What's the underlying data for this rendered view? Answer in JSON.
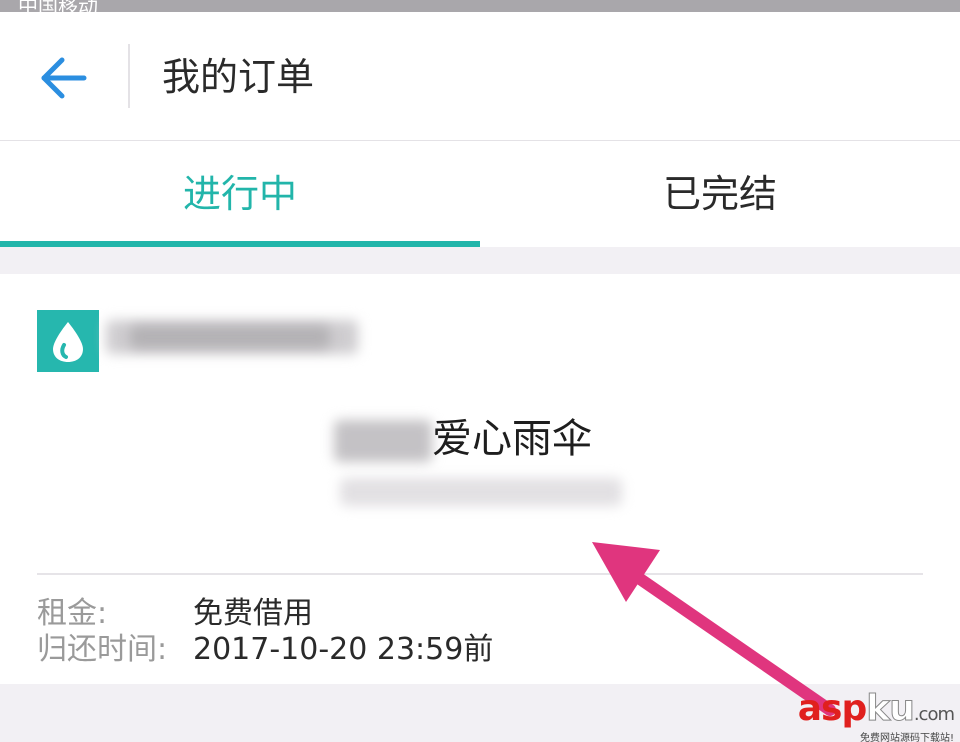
{
  "status_bar": {
    "carrier": "中国移动"
  },
  "header": {
    "title": "我的订单"
  },
  "tabs": [
    {
      "label": "进行中",
      "active": true
    },
    {
      "label": "已完结",
      "active": false
    }
  ],
  "order": {
    "item_name": "爱心雨伞",
    "rent_label": "租金:",
    "rent_value": "免费借用",
    "return_label": "归还时间:",
    "return_value": "2017-10-20 23:59前"
  },
  "watermark": {
    "brand_asp": "asp",
    "brand_ku": "ku",
    "brand_com": ".com",
    "tagline": "免费网站源码下载站!"
  },
  "colors": {
    "accent": "#22b5aa",
    "back_arrow": "#2b8ee0",
    "annotation": "#e0357e",
    "watermark_red": "#e0201e"
  },
  "icons": {
    "back": "arrow-left-icon",
    "merchant_logo": "water-drop-icon"
  }
}
